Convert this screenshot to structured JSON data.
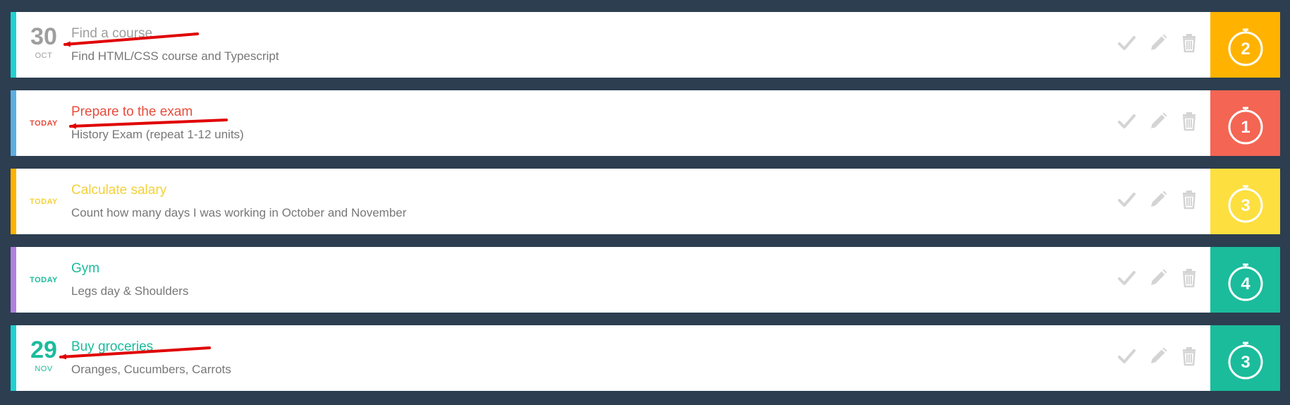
{
  "colors": {
    "background": "#2c3e50",
    "annotation_arrow": "#e00000",
    "action_icon": "#d4d4d4",
    "description_text": "#777777"
  },
  "icons": {
    "complete": "check-icon",
    "edit": "pencil-icon",
    "delete": "trash-icon",
    "priority": "timer-icon"
  },
  "tasks": [
    {
      "date_day": "30",
      "date_month": "OCT",
      "date_label": "",
      "date_color": "#9e9e9e",
      "title": "Find a course",
      "title_color": "#9e9e9e",
      "description": "Find HTML/CSS course and Typescript",
      "stripe_color": "#1fd1d1",
      "priority": "2",
      "priority_color": "#ffb300",
      "annotated": true
    },
    {
      "date_day": "",
      "date_month": "",
      "date_label": "TODAY",
      "date_color": "#e74c3c",
      "title": "Prepare to the exam",
      "title_color": "#e74c3c",
      "description": "History Exam (repeat 1-12 units)",
      "stripe_color": "#5dade2",
      "priority": "1",
      "priority_color": "#f46553",
      "annotated": true
    },
    {
      "date_day": "",
      "date_month": "",
      "date_label": "TODAY",
      "date_color": "#f3d13a",
      "title": "Calculate salary",
      "title_color": "#f3d13a",
      "description": "Count how many days I was working in October and November",
      "stripe_color": "#ffb300",
      "priority": "3",
      "priority_color": "#fddf3f",
      "annotated": false
    },
    {
      "date_day": "",
      "date_month": "",
      "date_label": "TODAY",
      "date_color": "#1abc9c",
      "title": "Gym",
      "title_color": "#1abc9c",
      "description": "Legs day & Shoulders",
      "stripe_color": "#b07fdf",
      "priority": "4",
      "priority_color": "#1abc9c",
      "annotated": false
    },
    {
      "date_day": "29",
      "date_month": "NOV",
      "date_label": "",
      "date_color": "#1abc9c",
      "title": "Buy groceries",
      "title_color": "#1abc9c",
      "description": "Oranges, Cucumbers, Carrots",
      "stripe_color": "#1fd1d1",
      "priority": "3",
      "priority_color": "#1abc9c",
      "annotated": true
    }
  ]
}
